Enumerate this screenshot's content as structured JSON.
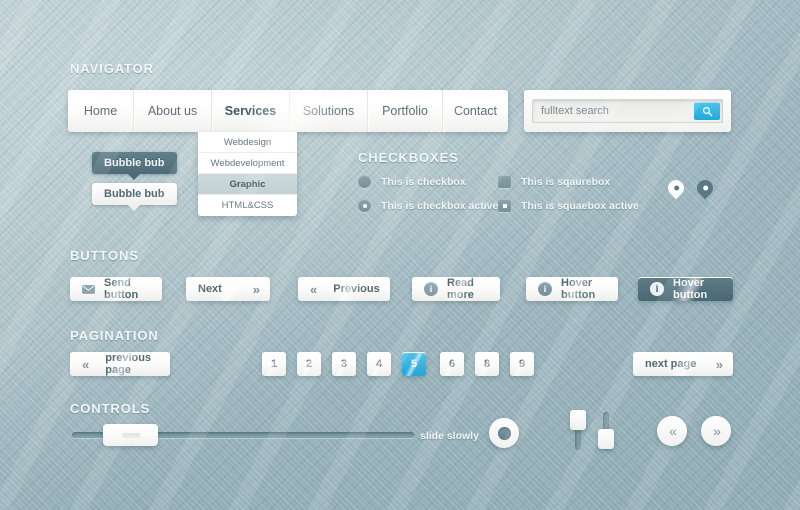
{
  "sections": {
    "navigator": "NAVIGATOR",
    "checkboxes": "CHECKBOXES",
    "buttons": "BUTTONS",
    "pagination": "PAGINATION",
    "controls": "CONTROLS"
  },
  "colors": {
    "background": "#a2bac1",
    "accent_blue": "#23a6da",
    "dark_slate": "#4e6b76",
    "panel_white": "#ffffff",
    "text_muted": "#5d6f77",
    "heading_light": "#f2f7f8"
  },
  "nav": {
    "items": [
      {
        "label": "Home",
        "active": false
      },
      {
        "label": "About us",
        "active": false
      },
      {
        "label": "Services",
        "active": true
      },
      {
        "label": "Solutions",
        "active": false
      },
      {
        "label": "Portfolio",
        "active": false
      },
      {
        "label": "Contact",
        "active": false
      }
    ],
    "dropdown": [
      {
        "label": "Webdesign",
        "active": false
      },
      {
        "label": "Webdevelopment",
        "active": false
      },
      {
        "label": "Graphic",
        "active": true
      },
      {
        "label": "HTML&CSS",
        "active": false
      }
    ]
  },
  "search": {
    "placeholder": "fulltext search",
    "value": "",
    "button_icon": "search-icon"
  },
  "bubbles": [
    {
      "label": "Bubble bub",
      "style": "dark"
    },
    {
      "label": "Bubble bub",
      "style": "light"
    }
  ],
  "checkboxes": [
    {
      "label": "This is checkbox",
      "shape": "round",
      "checked": false
    },
    {
      "label": "This is sqaurebox",
      "shape": "square",
      "checked": false
    },
    {
      "label": "This is checkbox active",
      "shape": "round",
      "checked": true
    },
    {
      "label": "This is squaebox active",
      "shape": "square",
      "checked": true
    }
  ],
  "pins": [
    {
      "style": "white"
    },
    {
      "style": "dark"
    }
  ],
  "buttons": [
    {
      "label": "Send button",
      "icon": "envelope-icon",
      "icon_pos": "left",
      "style": "light"
    },
    {
      "label": "Next",
      "icon": "chevron-right-double-icon",
      "icon_pos": "right",
      "style": "light"
    },
    {
      "label": "Previous",
      "icon": "chevron-left-double-icon",
      "icon_pos": "left",
      "style": "light"
    },
    {
      "label": "Read more",
      "icon": "info-icon",
      "icon_pos": "left",
      "style": "light"
    },
    {
      "label": "Hover button",
      "icon": "info-icon",
      "icon_pos": "left",
      "style": "light"
    },
    {
      "label": "Hover button",
      "icon": "info-icon",
      "icon_pos": "left",
      "style": "dark"
    }
  ],
  "pagination": {
    "prev_label": "previous page",
    "next_label": "next page",
    "prev_icon": "chevron-left-double-icon",
    "next_icon": "chevron-right-double-icon",
    "pages": [
      {
        "label": "1",
        "active": false
      },
      {
        "label": "2",
        "active": false
      },
      {
        "label": "3",
        "active": false
      },
      {
        "label": "4",
        "active": false
      },
      {
        "label": "5",
        "active": true
      },
      {
        "label": "6",
        "active": false
      },
      {
        "label": "8",
        "active": false
      },
      {
        "label": "9",
        "active": false
      }
    ]
  },
  "controls": {
    "slide_label": "slide slowly",
    "h_slider_value": 9,
    "v_slider_left_value": 80,
    "v_slider_right_value": 20,
    "prev_icon": "chevron-left-double-icon",
    "next_icon": "chevron-right-double-icon"
  }
}
